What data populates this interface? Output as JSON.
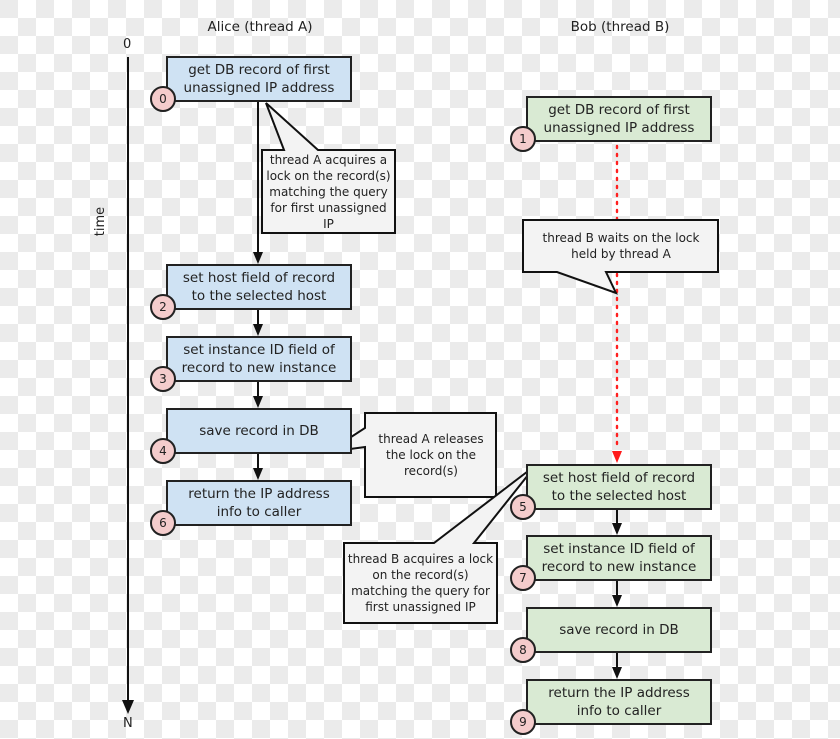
{
  "lanes": {
    "alice": "Alice (thread A)",
    "bob": "Bob (thread B)"
  },
  "time_axis": {
    "start": "0",
    "end": "N",
    "label": "time"
  },
  "colors": {
    "thread_a_fill": "#cfe2f3",
    "thread_b_fill": "#d9ead3",
    "step_number_fill": "#f4cccc",
    "callout_fill": "#f3f3f3",
    "wait_line": "#ff0000"
  },
  "steps": [
    {
      "num": "0",
      "lane": "alice",
      "text": "get DB record of first unassigned IP address"
    },
    {
      "num": "1",
      "lane": "bob",
      "text": "get DB record of first unassigned IP address"
    },
    {
      "num": "2",
      "lane": "alice",
      "text": "set host field of record to the selected host"
    },
    {
      "num": "3",
      "lane": "alice",
      "text": "set instance ID field of record to new instance"
    },
    {
      "num": "4",
      "lane": "alice",
      "text": "save record in DB"
    },
    {
      "num": "5",
      "lane": "bob",
      "text": "set host field of record to the selected host"
    },
    {
      "num": "6",
      "lane": "alice",
      "text": "return the IP address info to caller"
    },
    {
      "num": "7",
      "lane": "bob",
      "text": "set instance ID field of record to new instance"
    },
    {
      "num": "8",
      "lane": "bob",
      "text": "save record in DB"
    },
    {
      "num": "9",
      "lane": "bob",
      "text": "return the IP address info to caller"
    }
  ],
  "callouts": {
    "a_acquires": "thread A acquires a lock on the record(s) matching the query for first unassigned IP",
    "b_waits": "thread B waits on the lock held by thread A",
    "a_releases": "thread A releases the lock on the record(s)",
    "b_acquires": "thread B acquires a lock on the record(s) matching the query for first unassigned IP"
  }
}
